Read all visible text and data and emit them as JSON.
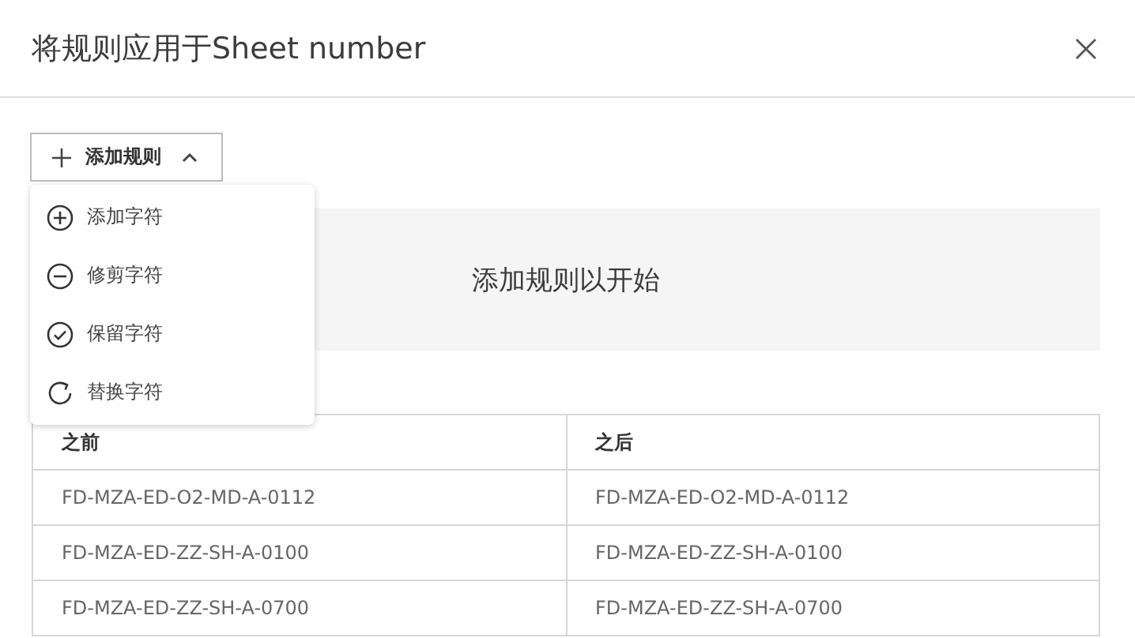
{
  "dialog": {
    "title": "将规则应用于Sheet number"
  },
  "add_rule_button": {
    "label": "添加规则",
    "expanded": true
  },
  "menu": [
    {
      "kind": "add",
      "label": "添加字符"
    },
    {
      "kind": "trim",
      "label": "修剪字符"
    },
    {
      "kind": "keep",
      "label": "保留字符"
    },
    {
      "kind": "replace",
      "label": "替换字符"
    }
  ],
  "empty_state": "添加规则以开始",
  "table": {
    "columns": [
      "之前",
      "之后"
    ],
    "rows": [
      [
        "FD-MZA-ED-O2-MD-A-0112",
        "FD-MZA-ED-O2-MD-A-0112"
      ],
      [
        "FD-MZA-ED-ZZ-SH-A-0100",
        "FD-MZA-ED-ZZ-SH-A-0100"
      ],
      [
        "FD-MZA-ED-ZZ-SH-A-0700",
        "FD-MZA-ED-ZZ-SH-A-0700"
      ]
    ]
  }
}
